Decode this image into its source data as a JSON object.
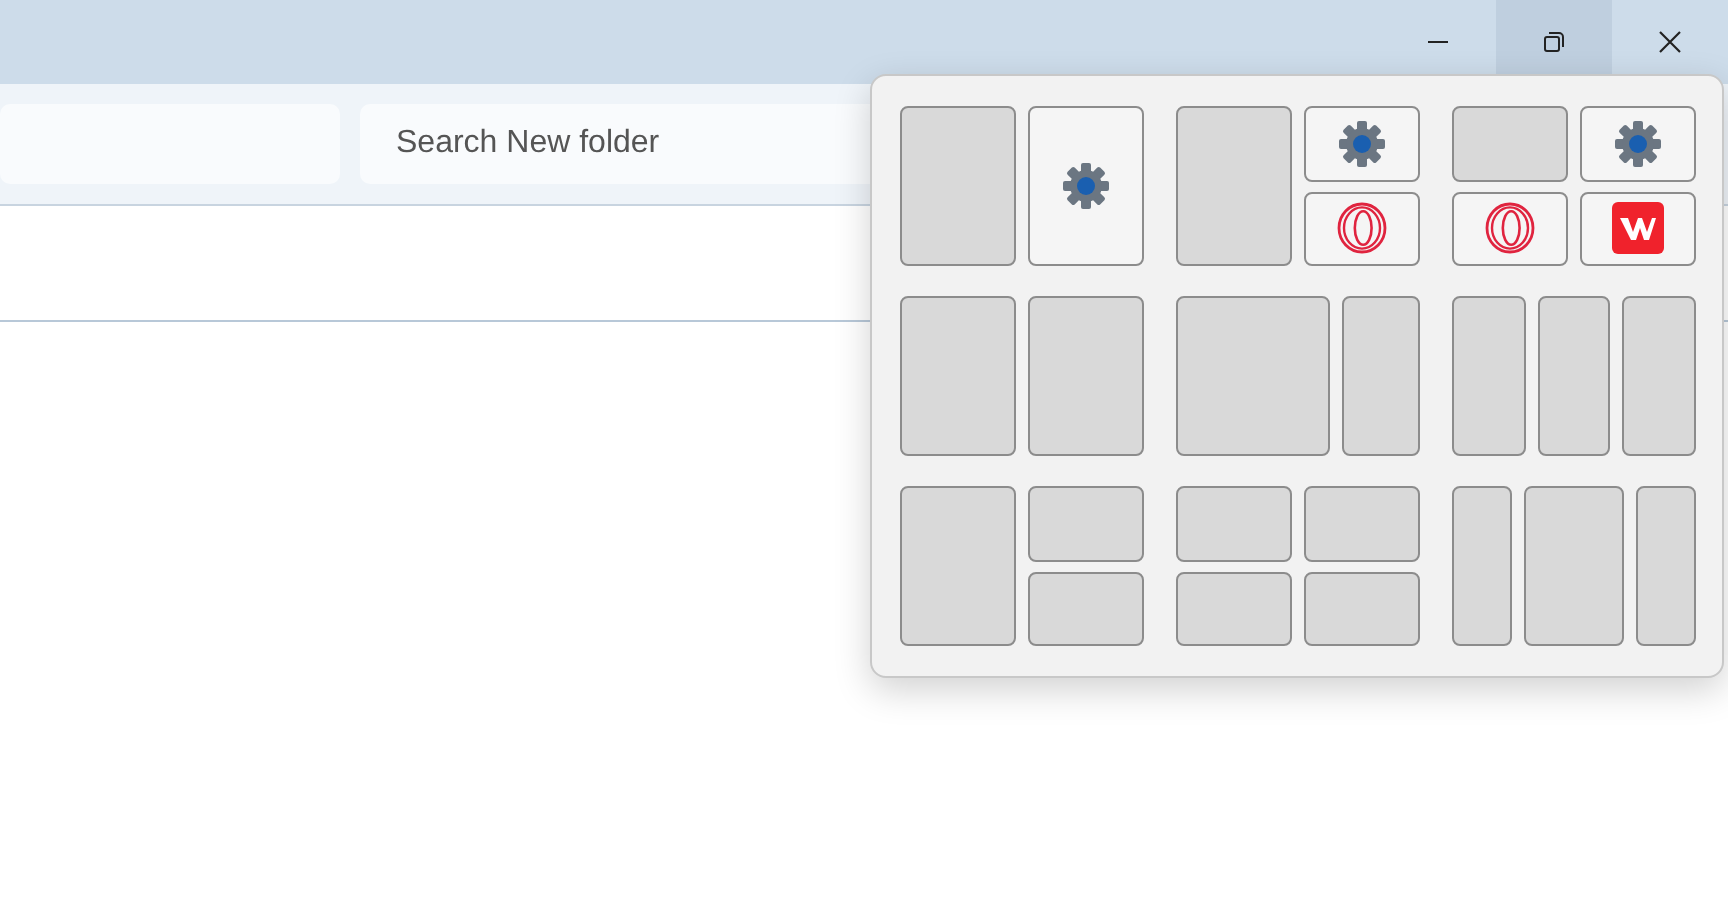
{
  "window": {
    "controls": [
      {
        "kind": "minimize",
        "hovered": false
      },
      {
        "kind": "restore",
        "hovered": true
      },
      {
        "kind": "close",
        "hovered": false
      }
    ]
  },
  "toolbar": {
    "search": {
      "placeholder": "Search New folder"
    }
  },
  "snap_layouts": [
    {
      "kind": "halves",
      "zones": [
        {
          "occupied": false
        },
        {
          "occupied": true,
          "kind": "gear"
        }
      ]
    },
    {
      "kind": "left-stack",
      "zones": [
        {
          "occupied": false
        },
        {
          "occupied": true,
          "kind": "gear"
        },
        {
          "occupied": true,
          "kind": "ring"
        }
      ]
    },
    {
      "kind": "quadrants",
      "zones": [
        {
          "occupied": false
        },
        {
          "occupied": true,
          "kind": "gear"
        },
        {
          "occupied": true,
          "kind": "ring"
        },
        {
          "occupied": true,
          "kind": "logo"
        }
      ]
    },
    {
      "kind": "halves",
      "zones": [
        {
          "occupied": false
        },
        {
          "occupied": false
        }
      ]
    },
    {
      "kind": "wide-left",
      "zones": [
        {
          "occupied": false
        },
        {
          "occupied": false
        }
      ]
    },
    {
      "kind": "thirds",
      "zones": [
        {
          "occupied": false
        },
        {
          "occupied": false
        },
        {
          "occupied": false
        }
      ]
    },
    {
      "kind": "left-stack",
      "zones": [
        {
          "occupied": false
        },
        {
          "occupied": false
        },
        {
          "occupied": false
        }
      ]
    },
    {
      "kind": "quadrants",
      "zones": [
        {
          "occupied": false
        },
        {
          "occupied": false
        },
        {
          "occupied": false
        },
        {
          "occupied": false
        }
      ]
    },
    {
      "kind": "center-wide",
      "zones": [
        {
          "occupied": false
        },
        {
          "occupied": false
        },
        {
          "occupied": false
        }
      ]
    }
  ]
}
